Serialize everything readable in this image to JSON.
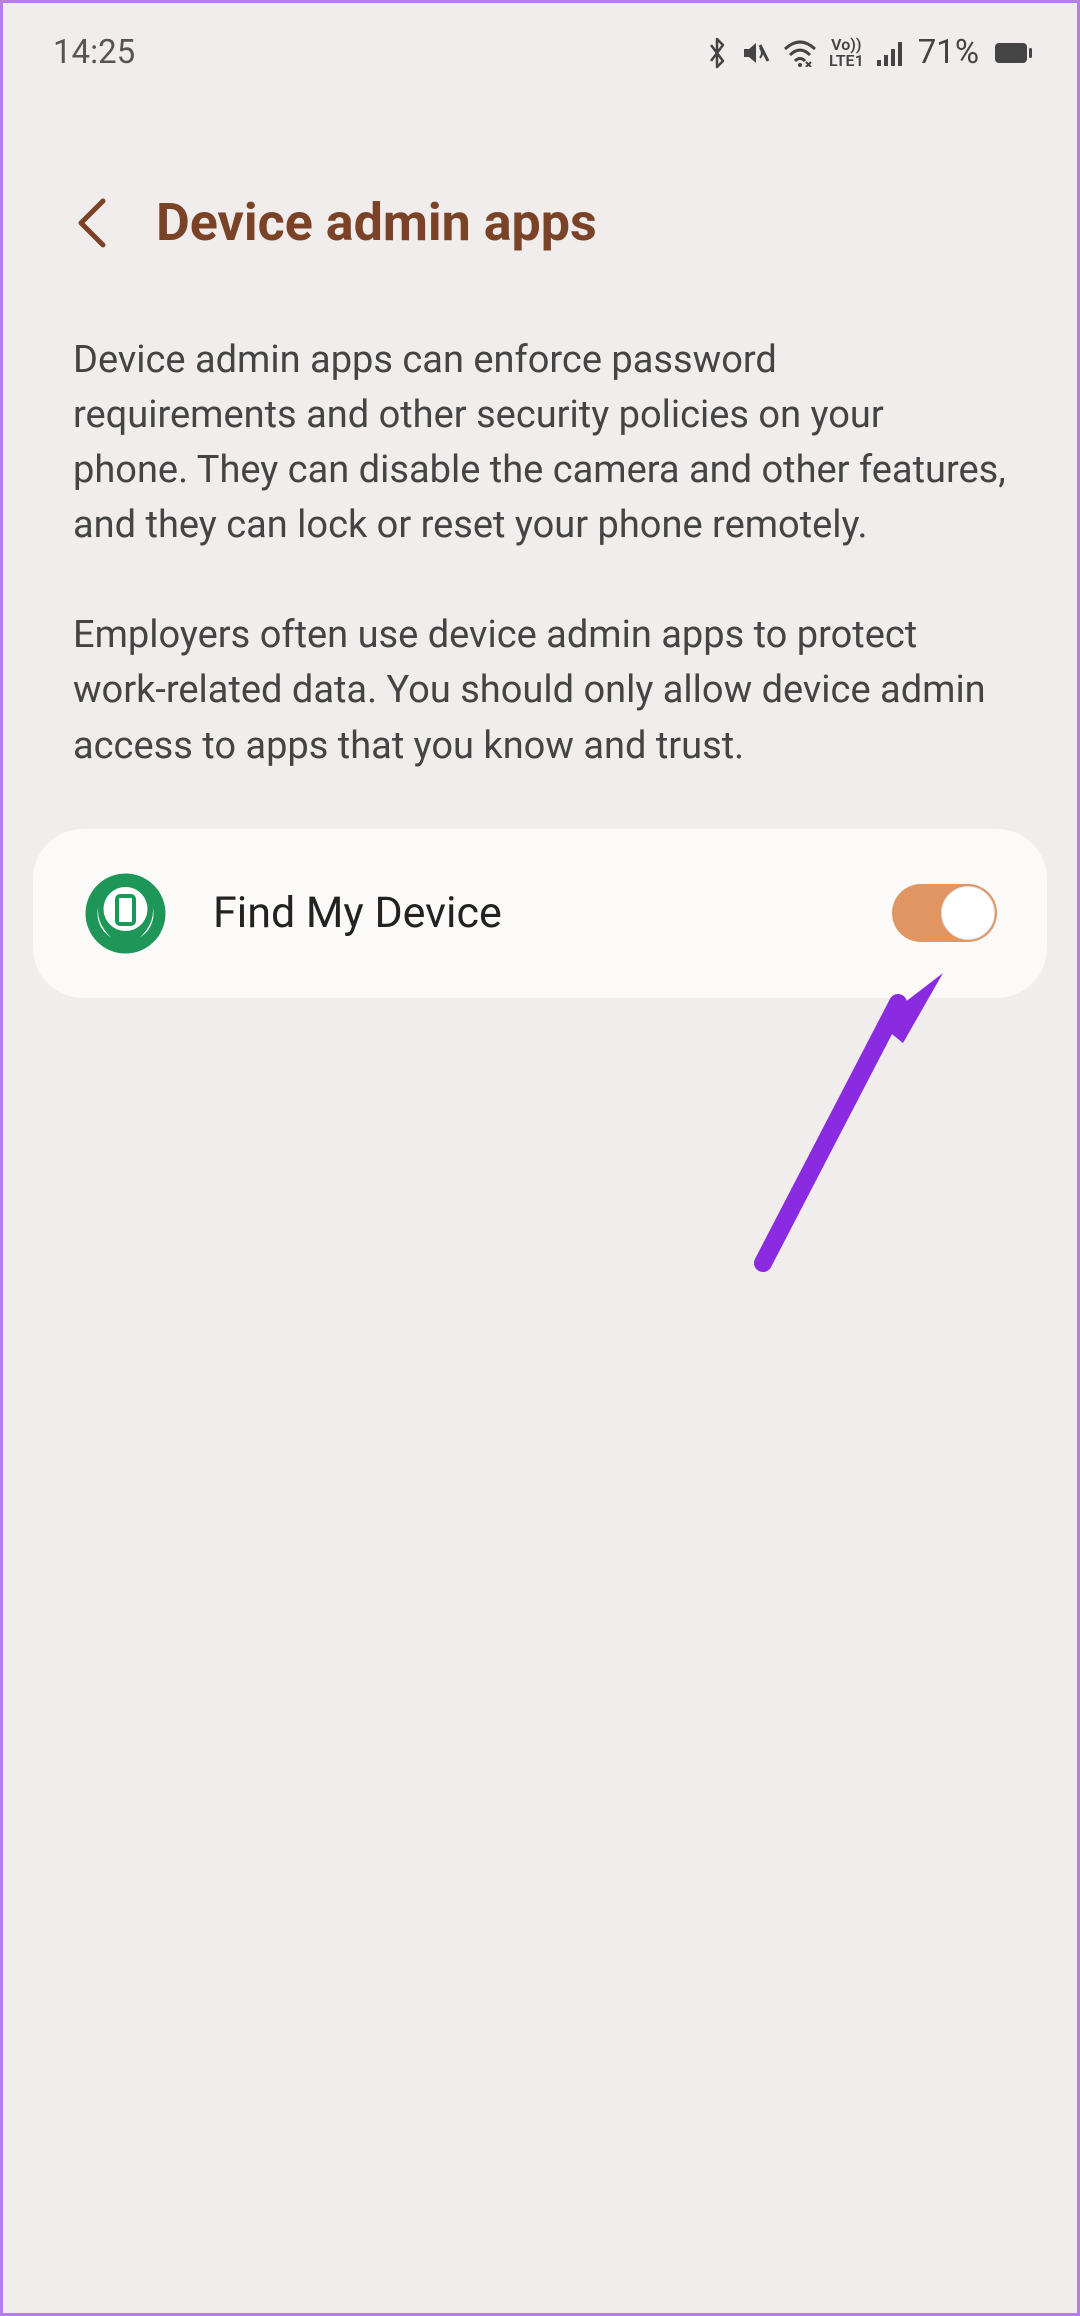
{
  "status_bar": {
    "time": "14:25",
    "battery_percent": "71%",
    "volte_top": "Vo))",
    "volte_bottom": "LTE1"
  },
  "header": {
    "title": "Device admin apps"
  },
  "description": {
    "para1": "Device admin apps can enforce password requirements and other security policies on your phone. They can disable the camera and other features, and they can lock or reset your phone remotely.",
    "para2": "Employers often use device admin apps to protect work-related data. You should only allow device admin access to apps that you know and trust."
  },
  "apps": [
    {
      "name": "Find My Device",
      "enabled": true
    }
  ]
}
